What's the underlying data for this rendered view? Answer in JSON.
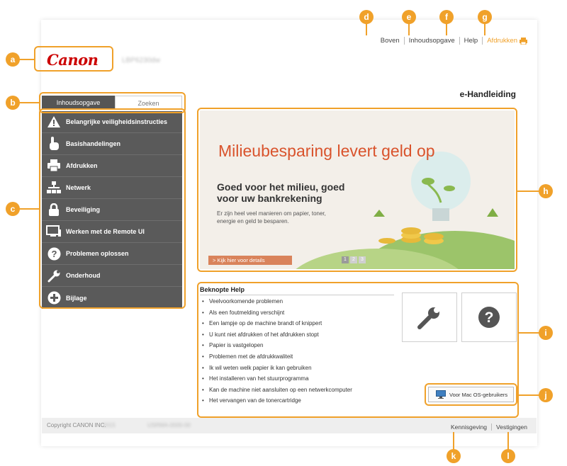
{
  "header": {
    "links": [
      "Boven",
      "Inhoudsopgave",
      "Help"
    ],
    "print_label": "Afdrukken",
    "logo_text": "Canon",
    "model_text": "LBP6230dw",
    "manual_title": "e-Handleiding"
  },
  "tabs": [
    "Inhoudsopgave",
    "Zoeken"
  ],
  "sidebar": {
    "items": [
      {
        "label": "Belangrijke veiligheidsinstructies",
        "icon": "warning-icon"
      },
      {
        "label": "Basishandelingen",
        "icon": "hand-icon"
      },
      {
        "label": "Afdrukken",
        "icon": "printer-icon"
      },
      {
        "label": "Netwerk",
        "icon": "network-icon"
      },
      {
        "label": "Beveiliging",
        "icon": "lock-icon"
      },
      {
        "label": "Werken met de Remote UI",
        "icon": "monitor-icon"
      },
      {
        "label": "Problemen oplossen",
        "icon": "question-icon"
      },
      {
        "label": "Onderhoud",
        "icon": "wrench-icon"
      },
      {
        "label": "Bijlage",
        "icon": "plus-icon"
      }
    ]
  },
  "banner": {
    "headline": "Milieubesparing levert geld op",
    "subhead": "Goed voor het milieu, goed voor uw bankrekening",
    "body": "Er zijn heel veel manieren om papier, toner, energie en geld te besparen.",
    "more_label": "> Kijk hier voor details",
    "pages": [
      "1",
      "2",
      "3"
    ]
  },
  "help": {
    "title": "Beknopte Help",
    "items": [
      "Veelvoorkomende problemen",
      "Als een foutmelding verschijnt",
      "Een lampje op de machine brandt of knippert",
      "U kunt niet afdrukken of het afdrukken stopt",
      "Papier is vastgelopen",
      "Problemen met de afdrukkwaliteit",
      "Ik wil weten welk papier ik kan gebruiken",
      "Het installeren van het stuurprogramma",
      "Kan de machine niet aansluiten op een netwerkcomputer",
      "Het vervangen van de tonercartridge"
    ],
    "mac_label": "Voor Mac OS-gebruikers"
  },
  "footer": {
    "copyright": "Copyright CANON INC.",
    "copyright_year": "2015",
    "product_code": "USRMA-0000-00",
    "links": [
      "Kennisgeving",
      "Vestigingen"
    ]
  },
  "callouts": [
    "a",
    "b",
    "c",
    "d",
    "e",
    "f",
    "g",
    "h",
    "i",
    "j",
    "k",
    "l"
  ],
  "colors": {
    "accent": "#f0a12a",
    "canon_red": "#cc0000",
    "nav_bg": "#5a5a5a",
    "banner_heading": "#d9532c"
  }
}
